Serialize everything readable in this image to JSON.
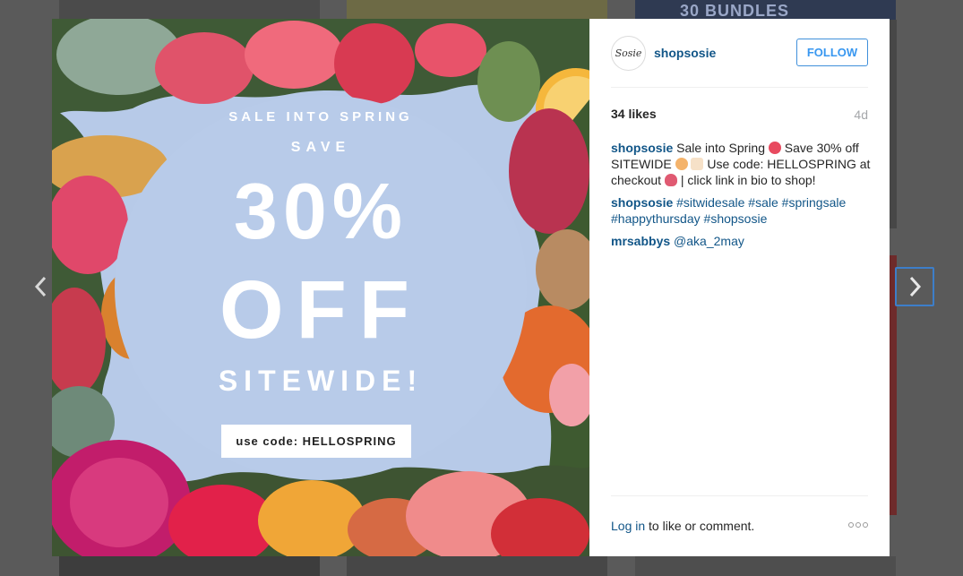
{
  "background": {
    "partial_tile_text": "30 BUNDLES"
  },
  "nav": {
    "prev_icon": "chevron-left-icon",
    "next_icon": "chevron-right-icon"
  },
  "post": {
    "image": {
      "line1": "SALE INTO SPRING",
      "line2": "SAVE",
      "big1": "30%",
      "big2": "OFF",
      "line3": "SITEWIDE!",
      "code": "use code: HELLOSPRING"
    },
    "author": {
      "username": "shopsosie",
      "avatar_text": "Sosie"
    },
    "follow_label": "FOLLOW",
    "likes": "34 likes",
    "age": "4d",
    "caption": {
      "user": "shopsosie",
      "part1": "Sale into Spring",
      "part2": "Save 30% off SITEWIDE",
      "part3": "Use code: HELLOSPRING at checkout",
      "part4": "| click link in bio to shop!"
    },
    "comments": [
      {
        "user": "shopsosie",
        "tags": [
          "#sitwidesale",
          "#sale",
          "#springsale",
          "#happythursday",
          "#shopsosie"
        ]
      },
      {
        "user": "mrsabbys",
        "text": "@aka_2may"
      }
    ],
    "login_link": "Log in",
    "login_rest": " to like or comment."
  },
  "colors": {
    "link": "#125688",
    "follow": "#3897f0",
    "overlay": "#5a5a5a"
  }
}
